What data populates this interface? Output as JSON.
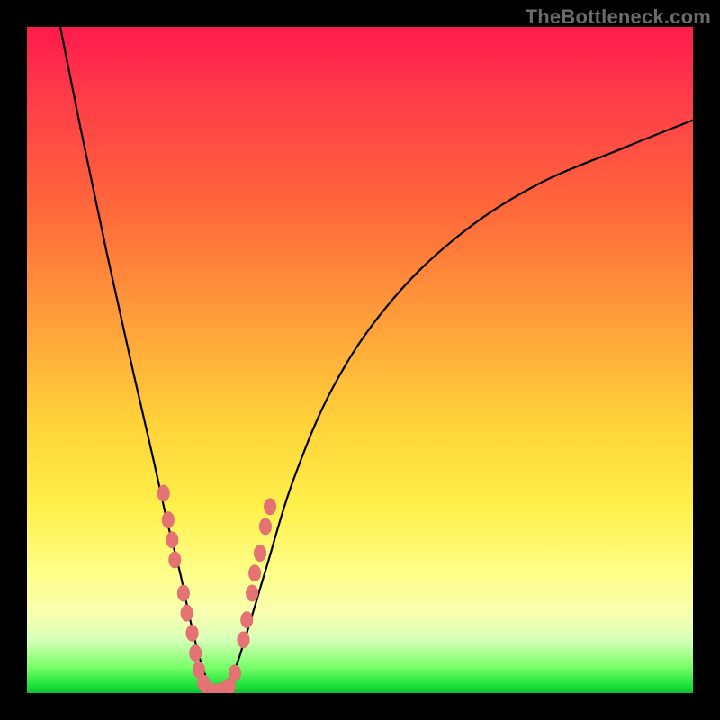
{
  "watermark": "TheBottleneck.com",
  "colors": {
    "frame_background": "#000000",
    "curve_stroke": "#000000",
    "marker_fill": "#e57373",
    "gradient_stops": [
      "#ff1a4d",
      "#ff6a3a",
      "#ffd43a",
      "#ffff8a",
      "#18e038"
    ]
  },
  "chart_data": {
    "type": "line",
    "title": "",
    "xlabel": "",
    "ylabel": "",
    "xrange": [
      0,
      100
    ],
    "yrange": [
      0,
      100
    ],
    "grid": false,
    "legend": false,
    "note": "Values are approximate percentage coordinates read from the figure (0,0 bottom-left). Curve is a V-shaped bottleneck profile. Markers cluster near the trough.",
    "series": [
      {
        "name": "bottleneck-curve",
        "x": [
          5,
          8,
          12,
          16,
          19,
          21,
          23,
          24.5,
          26,
          27.5,
          29,
          31,
          33,
          36,
          40,
          46,
          54,
          64,
          76,
          90,
          100
        ],
        "y": [
          100,
          85,
          66,
          48,
          35,
          26,
          18,
          11,
          5,
          1,
          0,
          3,
          9,
          19,
          32,
          46,
          58,
          68,
          76,
          82,
          86
        ]
      }
    ],
    "markers": {
      "name": "sampled-points",
      "points": [
        {
          "x": 20.5,
          "y": 30
        },
        {
          "x": 21.2,
          "y": 26
        },
        {
          "x": 21.8,
          "y": 23
        },
        {
          "x": 22.2,
          "y": 20
        },
        {
          "x": 23.5,
          "y": 15
        },
        {
          "x": 24.0,
          "y": 12
        },
        {
          "x": 24.8,
          "y": 9
        },
        {
          "x": 25.3,
          "y": 6
        },
        {
          "x": 25.8,
          "y": 3.5
        },
        {
          "x": 26.5,
          "y": 1.5
        },
        {
          "x": 27.2,
          "y": 0.5
        },
        {
          "x": 28.0,
          "y": 0.2
        },
        {
          "x": 28.8,
          "y": 0.2
        },
        {
          "x": 29.6,
          "y": 0.5
        },
        {
          "x": 30.4,
          "y": 1.0
        },
        {
          "x": 31.2,
          "y": 3.0
        },
        {
          "x": 32.5,
          "y": 8
        },
        {
          "x": 33.0,
          "y": 11
        },
        {
          "x": 33.8,
          "y": 15
        },
        {
          "x": 34.2,
          "y": 18
        },
        {
          "x": 35.0,
          "y": 21
        },
        {
          "x": 35.8,
          "y": 25
        },
        {
          "x": 36.5,
          "y": 28
        }
      ]
    }
  }
}
